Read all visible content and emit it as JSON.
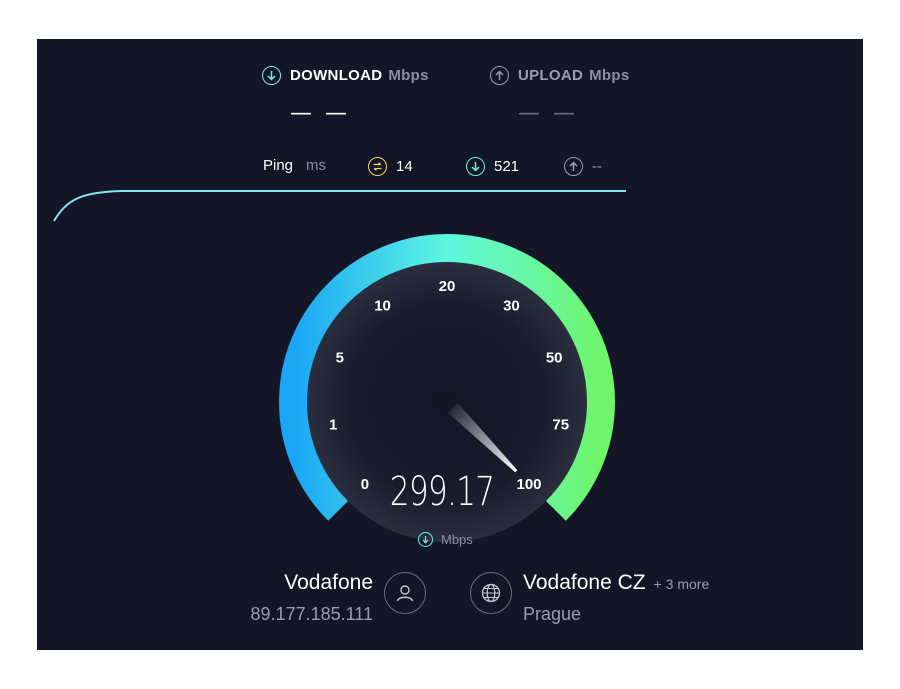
{
  "colors": {
    "panel_bg": "#141526",
    "download_accent": "#6ff3e6",
    "upload_accent": "#9a9db0",
    "ping_accent": "#f5d76e",
    "gauge_start": "#1aa5f6",
    "gauge_mid": "#5ef7e0",
    "gauge_end": "#6ff56b"
  },
  "download": {
    "label": "DOWNLOAD",
    "unit": "Mbps",
    "value": "— —",
    "icon": "arrow-down-circle-icon"
  },
  "upload": {
    "label": "UPLOAD",
    "unit": "Mbps",
    "value": "— —",
    "icon": "arrow-up-circle-icon"
  },
  "ping": {
    "label": "Ping",
    "unit": "ms",
    "idle": "14",
    "download": "521",
    "upload": "--"
  },
  "gauge": {
    "ticks": [
      "0",
      "1",
      "5",
      "10",
      "20",
      "30",
      "50",
      "75",
      "100"
    ],
    "reading": "299.17",
    "unit": "Mbps",
    "needle_value": 100
  },
  "provider": {
    "name": "Vodafone",
    "ip": "89.177.185.111",
    "icon": "user-icon"
  },
  "server": {
    "name": "Vodafone CZ",
    "more": "+ 3 more",
    "location": "Prague",
    "icon": "globe-icon"
  }
}
